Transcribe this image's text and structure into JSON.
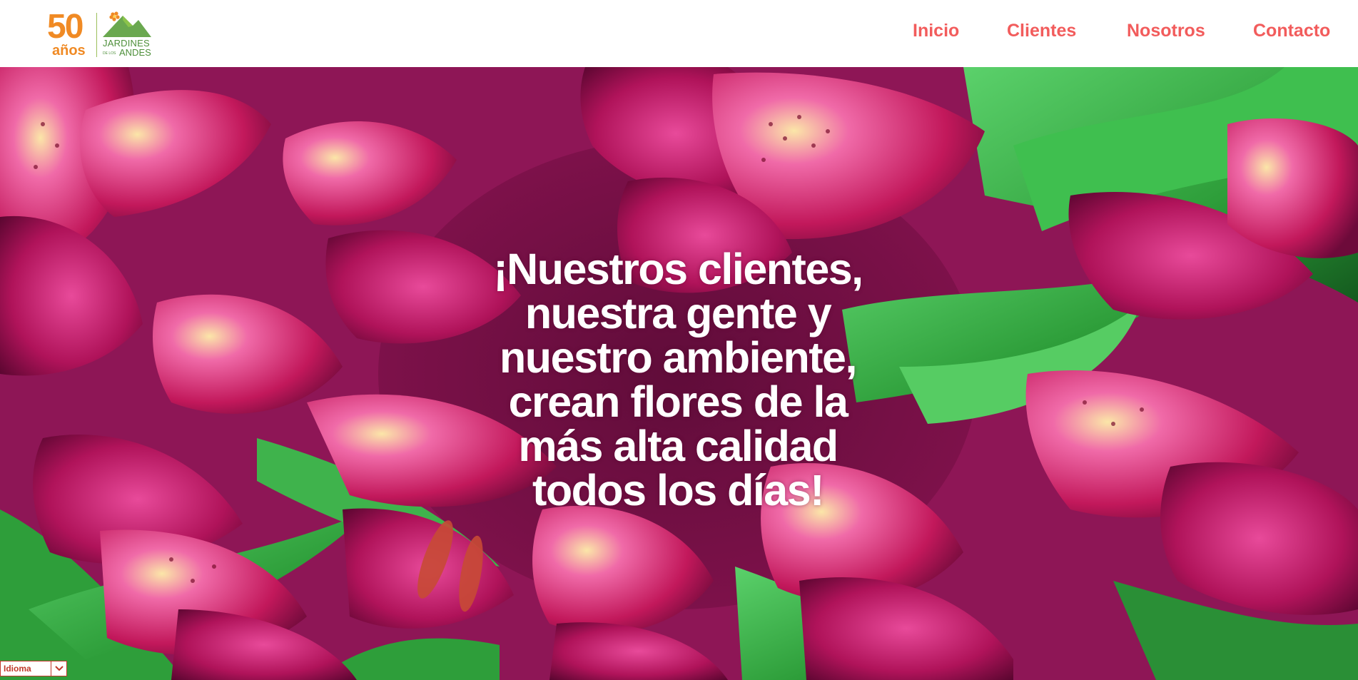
{
  "logo": {
    "years": "50",
    "years_word": "años",
    "brand_line1": "JARDINES",
    "brand_small": "DE LOS",
    "brand_line2": "ANDES"
  },
  "nav": {
    "items": [
      "Inicio",
      "Clientes",
      "Nosotros",
      "Contacto"
    ]
  },
  "hero": {
    "headline_lines": [
      "¡Nuestros clientes,",
      "nuestra gente y",
      "nuestro ambiente,",
      "crean flores de la",
      "más alta calidad",
      "todos los días!"
    ]
  },
  "language": {
    "label": "Idioma"
  },
  "colors": {
    "nav_text": "#f25c5c",
    "logo_orange": "#f08a24",
    "logo_green": "#4e8f3a",
    "petal_magenta": "#c2185b",
    "leaf_green": "#2e9e3a"
  },
  "icons": {
    "logo_mark": "flower-mountain-icon",
    "language_caret": "chevron-down-icon"
  }
}
